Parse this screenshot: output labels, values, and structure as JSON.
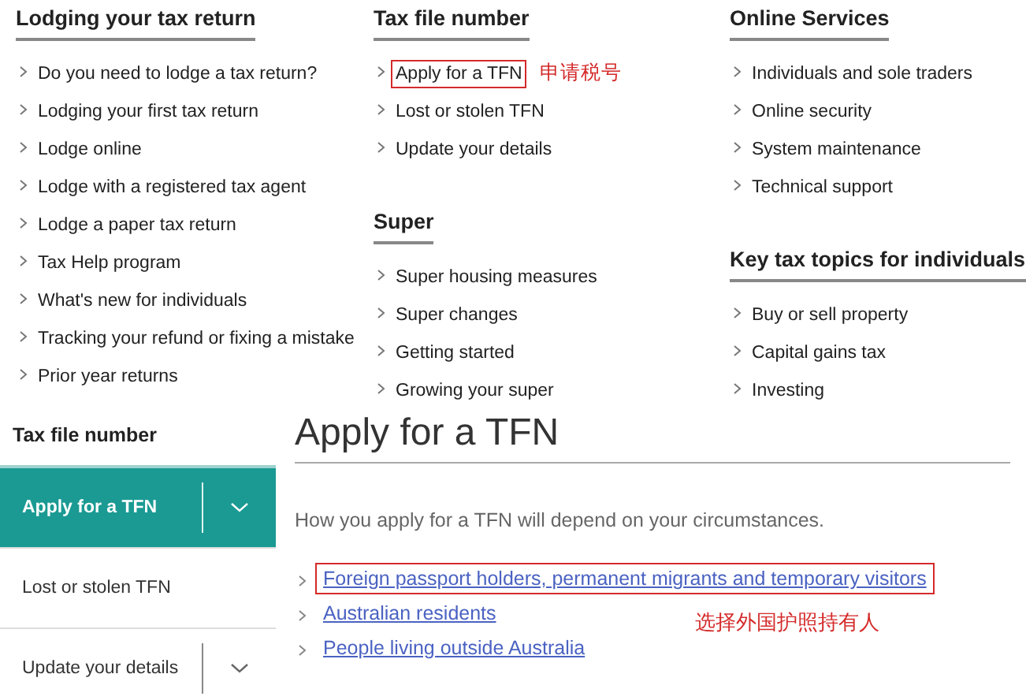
{
  "columns": [
    {
      "sections": [
        {
          "heading": "Lodging your tax return",
          "items": [
            {
              "label": "Do you need to lodge a tax return?",
              "highlighted": false
            },
            {
              "label": "Lodging your first tax return",
              "highlighted": false
            },
            {
              "label": "Lodge online",
              "highlighted": false
            },
            {
              "label": "Lodge with a registered tax agent",
              "highlighted": false
            },
            {
              "label": "Lodge a paper tax return",
              "highlighted": false
            },
            {
              "label": "Tax Help program",
              "highlighted": false
            },
            {
              "label": "What's new for individuals",
              "highlighted": false
            },
            {
              "label": "Tracking your refund or fixing a mistake",
              "highlighted": false
            },
            {
              "label": "Prior year returns",
              "highlighted": false
            }
          ]
        }
      ]
    },
    {
      "sections": [
        {
          "heading": "Tax file number",
          "items": [
            {
              "label": "Apply for a TFN",
              "highlighted": true,
              "note": "申请税号"
            },
            {
              "label": "Lost or stolen TFN",
              "highlighted": false
            },
            {
              "label": "Update your details",
              "highlighted": false
            }
          ]
        },
        {
          "heading": "Super",
          "items": [
            {
              "label": "Super housing measures",
              "highlighted": false
            },
            {
              "label": "Super changes",
              "highlighted": false
            },
            {
              "label": "Getting started",
              "highlighted": false
            },
            {
              "label": "Growing your super",
              "highlighted": false
            }
          ]
        }
      ]
    },
    {
      "sections": [
        {
          "heading": "Online Services",
          "items": [
            {
              "label": "Individuals and sole traders",
              "highlighted": false
            },
            {
              "label": "Online security",
              "highlighted": false
            },
            {
              "label": "System maintenance",
              "highlighted": false
            },
            {
              "label": "Technical support",
              "highlighted": false
            }
          ]
        },
        {
          "heading": "Key tax topics for individuals",
          "items": [
            {
              "label": "Buy or sell property",
              "highlighted": false
            },
            {
              "label": "Capital gains tax",
              "highlighted": false
            },
            {
              "label": "Investing",
              "highlighted": false
            }
          ]
        }
      ]
    }
  ],
  "sidebar": {
    "title": "Tax file number",
    "items": [
      {
        "label": "Apply for a TFN",
        "selected": true,
        "expandable": true
      },
      {
        "label": "Lost or stolen TFN",
        "selected": false,
        "expandable": false
      },
      {
        "label": "Update your details",
        "selected": false,
        "expandable": true
      }
    ]
  },
  "main": {
    "title": "Apply for a TFN",
    "intro": "How you apply for a TFN will depend on your circumstances.",
    "links": [
      {
        "label": "Foreign passport holders, permanent migrants and temporary visitors",
        "highlighted": true
      },
      {
        "label": "Australian residents",
        "highlighted": false
      },
      {
        "label": "People living outside Australia",
        "highlighted": false
      }
    ],
    "note": "选择外国护照持有人"
  }
}
